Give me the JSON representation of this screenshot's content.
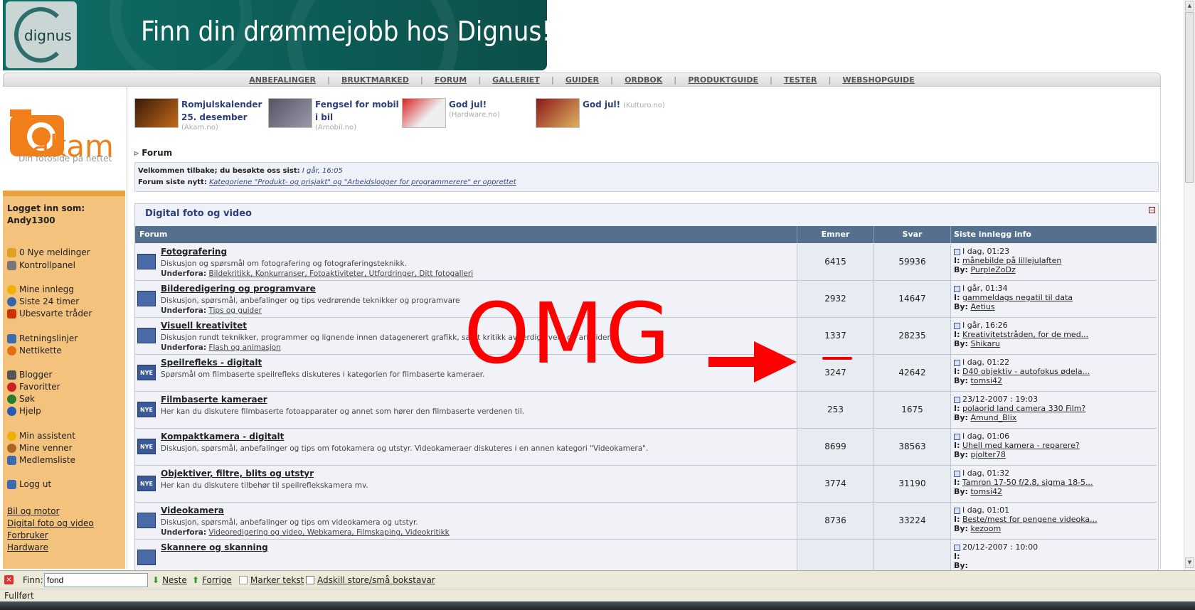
{
  "banner": {
    "logo_text": "dignus",
    "headline": "Finn din drømmejobb hos Dignus!"
  },
  "topnav": [
    "ANBEFALINGER",
    "BRUKTMARKED",
    "FORUM",
    "GALLERIET",
    "GUIDER",
    "ORDBOK",
    "PRODUKTGUIDE",
    "TESTER",
    "WEBSHOPGUIDE"
  ],
  "site": {
    "logo": "akam",
    "tagline": "Din fotoside på nettet"
  },
  "user": {
    "logged_in_label": "Logget inn som:",
    "username": "Andy1300"
  },
  "menu": [
    {
      "label": "0 Nye meldinger",
      "icon": "envelope-icon",
      "color": "#e0a020"
    },
    {
      "label": "Kontrollpanel",
      "icon": "tools-icon",
      "color": "#777777"
    },
    {
      "label": "Mine innlegg",
      "icon": "smiley-icon",
      "color": "#f0b000"
    },
    {
      "label": "Siste 24 timer",
      "icon": "clock-icon",
      "color": "#3366aa"
    },
    {
      "label": "Ubesvarte tråder",
      "icon": "arrows-icon",
      "color": "#cc3300"
    },
    {
      "label": "Retningslinjer",
      "icon": "document-icon",
      "color": "#3a6ab0"
    },
    {
      "label": "Nettikette",
      "icon": "alert-icon",
      "color": "#e07010"
    },
    {
      "label": "Blogger",
      "icon": "blog-icon",
      "color": "#555555"
    },
    {
      "label": "Favoritter",
      "icon": "heart-icon",
      "color": "#cc2222"
    },
    {
      "label": "Søk",
      "icon": "search-icon",
      "color": "#2a7a2a"
    },
    {
      "label": "Hjelp",
      "icon": "help-icon",
      "color": "#2a5ab0"
    },
    {
      "label": "Min assistent",
      "icon": "assistant-icon",
      "color": "#f0b000"
    },
    {
      "label": "Mine venner",
      "icon": "friends-icon",
      "color": "#aa6622"
    },
    {
      "label": "Medlemsliste",
      "icon": "members-icon",
      "color": "#3a6ab0"
    },
    {
      "label": "Logg ut",
      "icon": "logout-icon",
      "color": "#3a6ab0"
    }
  ],
  "bottom_links": [
    "Bil og motor",
    "Digital foto og video",
    "Forbruker",
    "Hardware"
  ],
  "promos": [
    {
      "title_1": "Romjulskalender",
      "title_2": "25. desember",
      "source": "(Akam.no)"
    },
    {
      "title_1": "Fengsel for mobil",
      "title_2": "i bil",
      "source": "(Amobil.no)"
    },
    {
      "title_1": "God jul!",
      "title_2": "",
      "source": "(Hardware.no)"
    },
    {
      "title_1": "God jul!",
      "title_2": "",
      "source": "(Kulturo.no)"
    }
  ],
  "breadcrumb": "Forum",
  "welcome": {
    "line1_label": "Velkommen tilbake; du besøkte oss sist:",
    "line1_value": "I går, 16:05",
    "line2_label": "Forum siste nytt:",
    "line2_value": "Kategoriene \"Produkt- og prisjakt\" og \"Arbeidslogger for programmerere\" er opprettet"
  },
  "forum_section": {
    "title": "Digital foto og video",
    "columns": {
      "forum": "Forum",
      "topics": "Emner",
      "replies": "Svar",
      "last": "Siste innlegg info"
    },
    "rows": [
      {
        "name": "Fotografering",
        "desc": "Diskusjon og spørsmål om fotografering og fotograferingsteknikk.",
        "sub_label": "Underfora:",
        "sub": "Bildekritikk, Konkurranser, Fotoaktiviteter, Utfordringer, Ditt fotogalleri",
        "topics": "6415",
        "replies": "59936",
        "last_time": "I dag, 01:23",
        "last_topic": "månebilde på lillejulaften",
        "last_by": "PurpleZoDz",
        "icon": ""
      },
      {
        "name": "Bilderedigering og programvare",
        "desc": "Diskusjon, spørsmål, anbefalinger og tips vedrørende teknikker og programvare",
        "sub_label": "Underfora:",
        "sub": "Tips og guider",
        "topics": "2932",
        "replies": "14647",
        "last_time": "I går, 01:34",
        "last_topic": "gammeldags negatil til data",
        "last_by": "Aetius",
        "icon": ""
      },
      {
        "name": "Visuell kreativitet",
        "desc": "Diskusjon rundt teknikker, programmer og lignende innen datagenerert grafikk, samt kritikk av ferdige verk og arbeider.",
        "sub_label": "Underfora:",
        "sub": "Flash og animasjon",
        "topics": "1337",
        "replies": "28235",
        "last_time": "I går, 16:26",
        "last_topic": "Kreativitetstråden, for de med...",
        "last_by": "Shikaru",
        "icon": ""
      },
      {
        "name": "Speilrefleks - digitalt",
        "desc": "Spørsmål om filmbaserte speilrefleks diskuteres i kategorien for filmbaserte kameraer.",
        "sub_label": "",
        "sub": "",
        "topics": "3247",
        "replies": "42642",
        "last_time": "I dag, 01:22",
        "last_topic": "D40 objektiv - autofokus ødela...",
        "last_by": "tomsi42",
        "icon": "NYE"
      },
      {
        "name": "Filmbaserte kameraer",
        "desc": "Her kan du diskutere filmbaserte fotoapparater og annet som hører den filmbaserte verdenen til.",
        "sub_label": "",
        "sub": "",
        "topics": "253",
        "replies": "1675",
        "last_time": "23/12-2007 : 19:03",
        "last_topic": "polaorid land camera 330 Film?",
        "last_by": "Amund_Blix",
        "icon": "NYE"
      },
      {
        "name": "Kompaktkamera - digitalt",
        "desc": "Diskusjon, spørsmål, anbefalinger og tips om fotokamera og utstyr. Videokameraer diskuteres i en annen kategori \"Videokamera\".",
        "sub_label": "",
        "sub": "",
        "topics": "8699",
        "replies": "38563",
        "last_time": "I dag, 01:06",
        "last_topic": "Uhell med kamera - reparere?",
        "last_by": "pjolter78",
        "icon": "NYE"
      },
      {
        "name": "Objektiver, filtre, blits og utstyr",
        "desc": "Her kan du diskutere tilbehør til speilreflekskamera mv.",
        "sub_label": "",
        "sub": "",
        "topics": "3774",
        "replies": "31190",
        "last_time": "I dag, 01:32",
        "last_topic": "Tamron 17-50 f/2.8, sigma 18-5...",
        "last_by": "tomsi42",
        "icon": "NYE"
      },
      {
        "name": "Videokamera",
        "desc": "Diskusjon, spørsmål, anbefalinger og tips om videokamera og utstyr.",
        "sub_label": "Underfora:",
        "sub": "Videoredigering og video, Webkamera, Filmskaping, Videokritikk",
        "topics": "8736",
        "replies": "33224",
        "last_time": "I dag, 01:01",
        "last_topic": "Beste/mest for pengene videoka...",
        "last_by": "kezoom",
        "icon": ""
      },
      {
        "name": "Skannere og skanning",
        "desc": "",
        "sub_label": "",
        "sub": "",
        "topics": "",
        "replies": "",
        "last_time": "20/12-2007 : 10:00",
        "last_topic": "",
        "last_by": "",
        "icon": ""
      }
    ],
    "label_I": "I:",
    "label_by": "By:"
  },
  "overlay": {
    "text": "OMG",
    "color": "#ff0000"
  },
  "findbar": {
    "label": "Finn:",
    "value": "fond",
    "next": "Neste",
    "prev": "Forrige",
    "highlight": "Marker tekst",
    "match_case": "Adskill store/små bokstavar"
  },
  "status": "Fullført"
}
